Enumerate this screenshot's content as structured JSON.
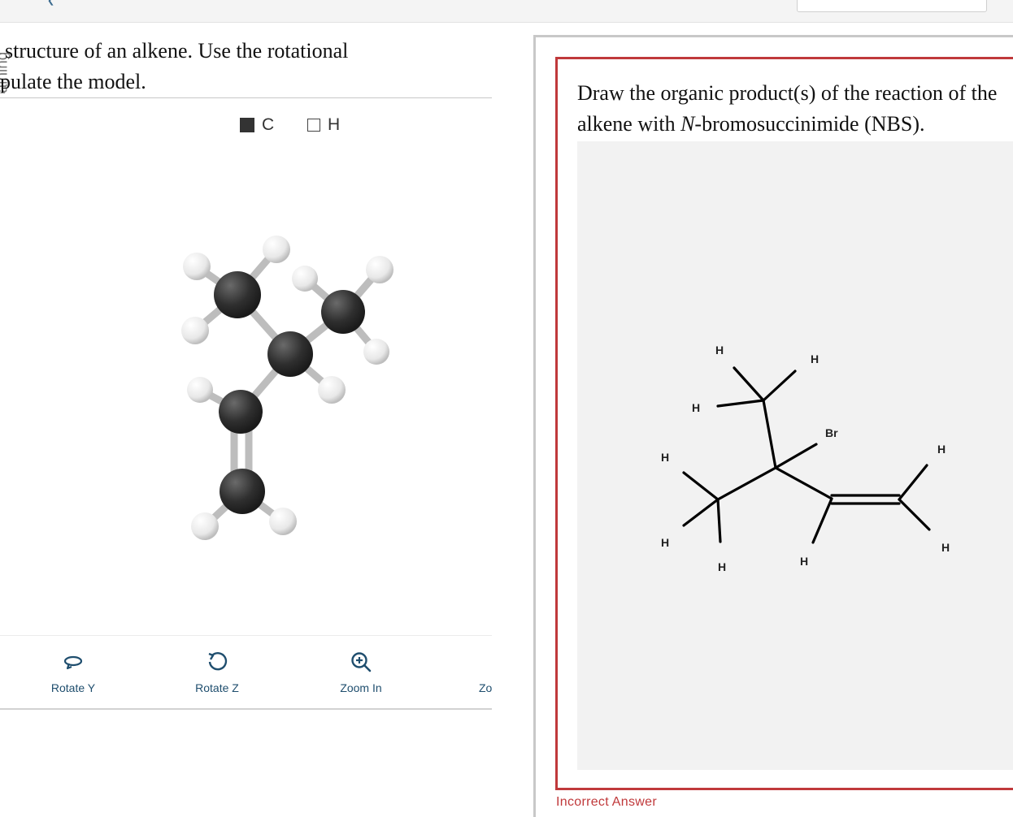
{
  "question": {
    "line1": "structure of an alkene. Use the rotational",
    "line2": "pulate the model."
  },
  "side_tab": {
    "label": "aining"
  },
  "legend": [
    {
      "label": "C",
      "style": "filled"
    },
    {
      "label": "H",
      "style": "empty"
    }
  ],
  "toolbar": {
    "rotate_y_label": "Rotate Y",
    "rotate_z_label": "Rotate Z",
    "zoom_in_label": "Zoom In",
    "zoom_out_label": "Zo"
  },
  "answer": {
    "prompt_line1": "Draw the organic product(s) of the reaction of the",
    "prompt_line2_before": "alkene with ",
    "prompt_line2_italic": "N",
    "prompt_line2_after": "-bromosuccinimide (NBS).",
    "feedback": "Incorrect Answer"
  },
  "structure": {
    "atom_labels": [
      "H",
      "H",
      "H",
      "Br",
      "H",
      "H",
      "H",
      "H",
      "H",
      "H"
    ]
  },
  "colors": {
    "accent": "#1f4e6e",
    "error": "#c0393b",
    "carbon": "#333333",
    "hydrogen": "#f2f2f2"
  },
  "icons": [
    "undo-rotate-y-icon",
    "rotate-z-icon",
    "zoom-in-icon"
  ]
}
